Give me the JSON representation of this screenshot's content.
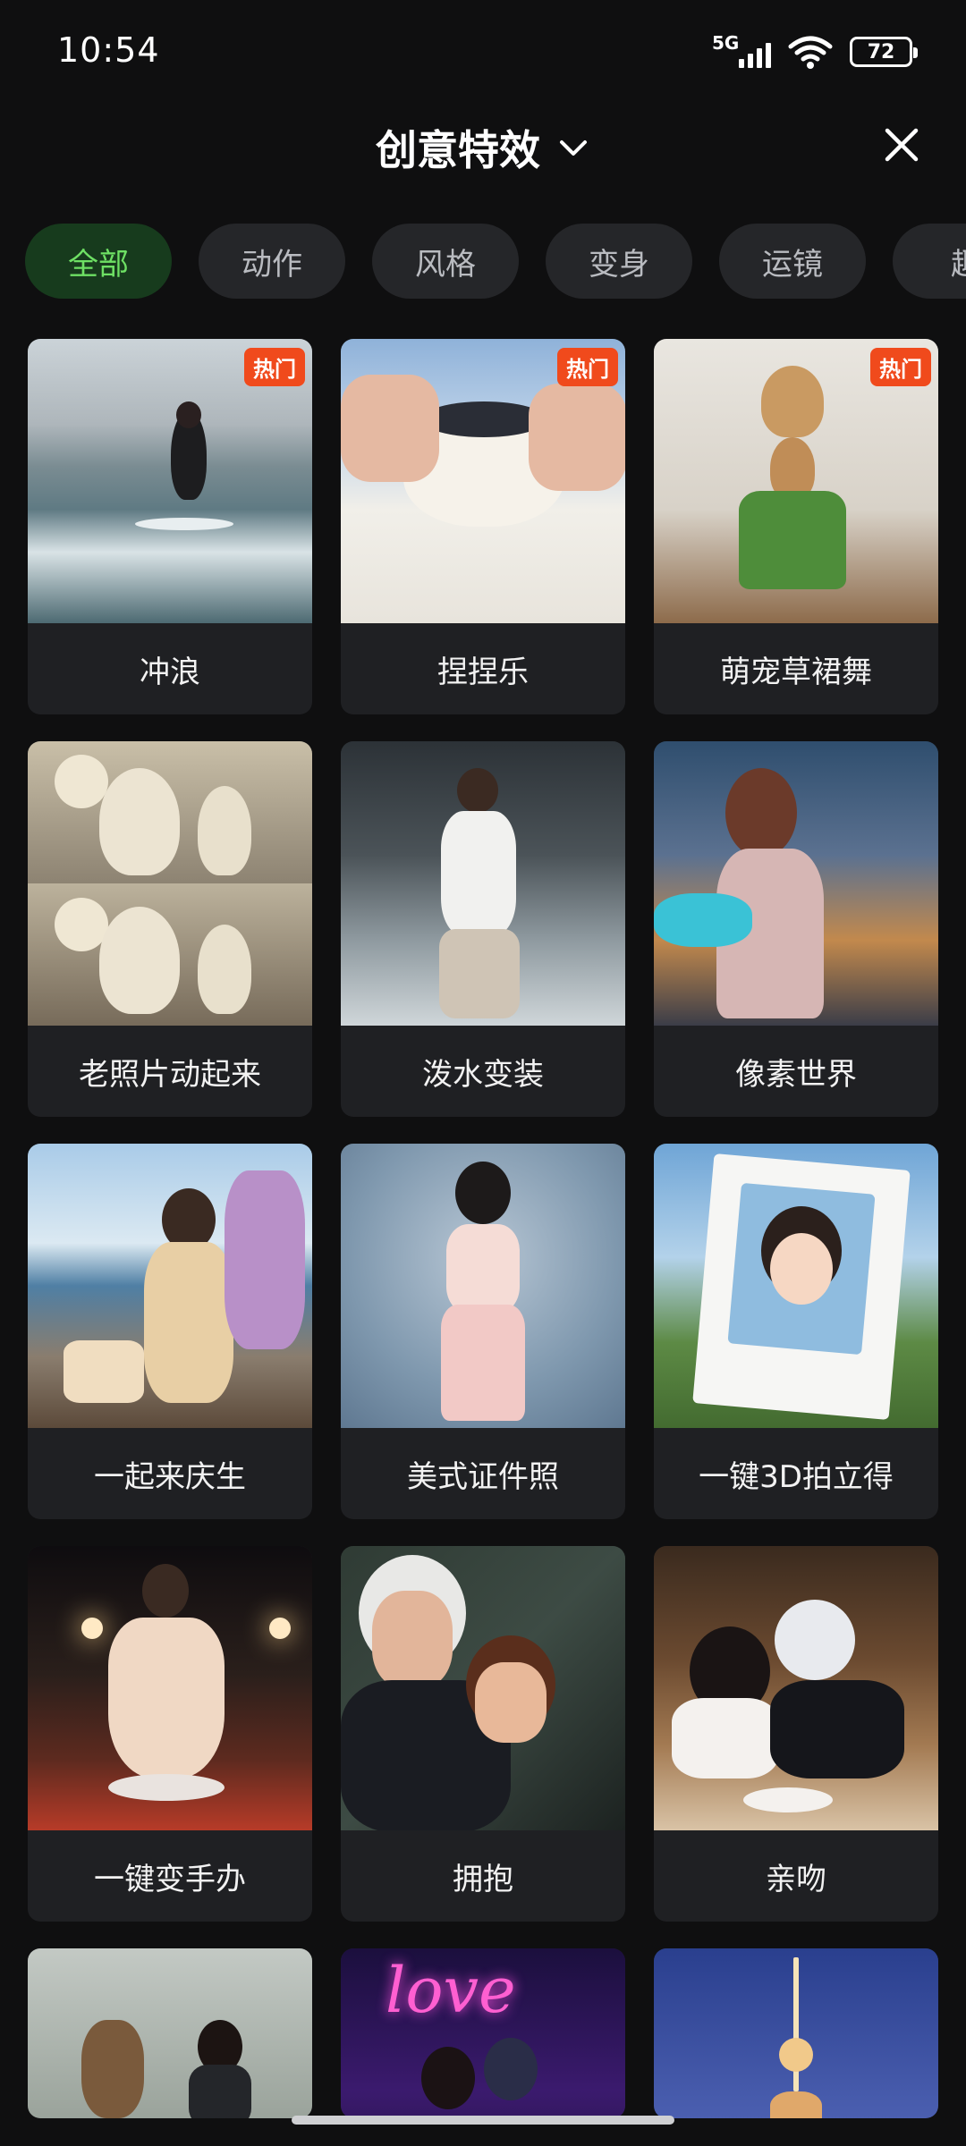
{
  "status_bar": {
    "time": "10:54",
    "network": "5G",
    "battery": "72",
    "icons": [
      "signal-icon",
      "wifi-icon",
      "battery-icon"
    ]
  },
  "header": {
    "title": "创意特效",
    "dropdown_icon": "chevron-down-icon",
    "close_icon": "close-icon"
  },
  "chips": [
    {
      "label": "全部",
      "active": true
    },
    {
      "label": "动作",
      "active": false
    },
    {
      "label": "风格",
      "active": false
    },
    {
      "label": "变身",
      "active": false
    },
    {
      "label": "运镜",
      "active": false
    },
    {
      "label": "趣",
      "active": false
    }
  ],
  "colors": {
    "background": "#0f0f10",
    "card": "#1f2023",
    "chip": "#252629",
    "chip_active_bg": "#173b1d",
    "chip_active_text": "#6ee064",
    "hot_badge": "#f04a1c"
  },
  "hot_badge_label": "热门",
  "effects": [
    {
      "label": "冲浪",
      "hot": true
    },
    {
      "label": "捏捏乐",
      "hot": true
    },
    {
      "label": "萌宠草裙舞",
      "hot": true
    },
    {
      "label": "老照片动起来",
      "hot": false
    },
    {
      "label": "泼水变装",
      "hot": false
    },
    {
      "label": "像素世界",
      "hot": false
    },
    {
      "label": "一起来庆生",
      "hot": false
    },
    {
      "label": "美式证件照",
      "hot": false
    },
    {
      "label": "一键3D拍立得",
      "hot": false
    },
    {
      "label": "一键变手办",
      "hot": false
    },
    {
      "label": "拥抱",
      "hot": false
    },
    {
      "label": "亲吻",
      "hot": false
    }
  ],
  "partial_cards": {
    "love_text": "love"
  }
}
